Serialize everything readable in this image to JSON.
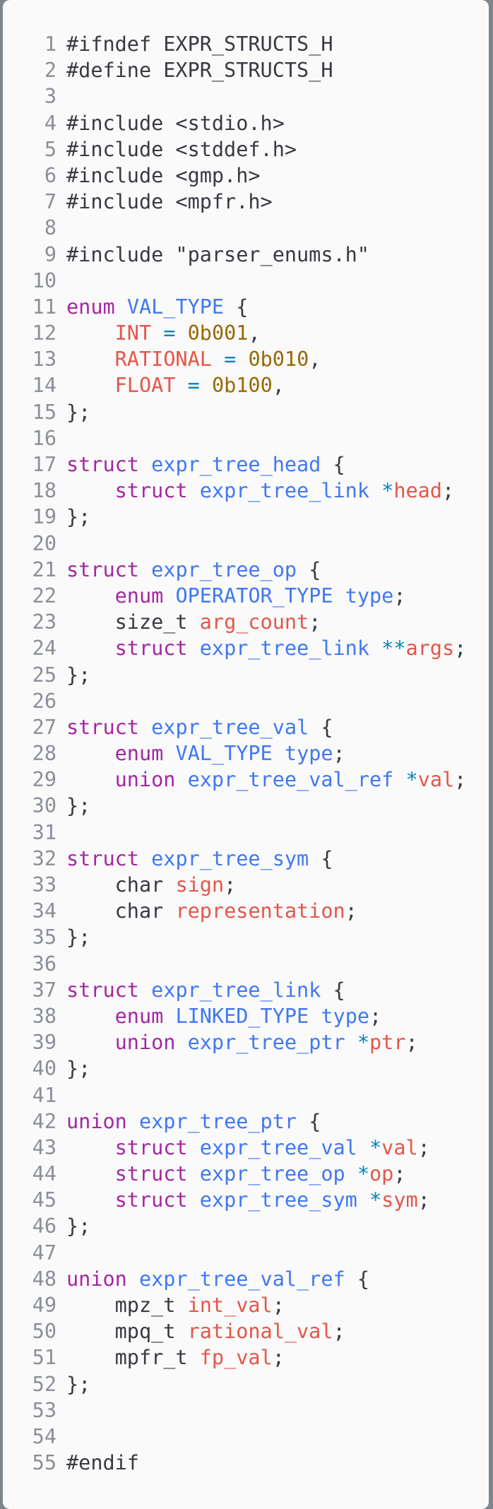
{
  "editor": {
    "language": "c",
    "lines": [
      {
        "n": "1",
        "t": [
          [
            "pp",
            "#ifndef EXPR_STRUCTS_H"
          ]
        ]
      },
      {
        "n": "2",
        "t": [
          [
            "pp",
            "#define EXPR_STRUCTS_H"
          ]
        ]
      },
      {
        "n": "3",
        "t": []
      },
      {
        "n": "4",
        "t": [
          [
            "pp",
            "#include <stdio.h>"
          ]
        ]
      },
      {
        "n": "5",
        "t": [
          [
            "pp",
            "#include <stddef.h>"
          ]
        ]
      },
      {
        "n": "6",
        "t": [
          [
            "pp",
            "#include <gmp.h>"
          ]
        ]
      },
      {
        "n": "7",
        "t": [
          [
            "pp",
            "#include <mpfr.h>"
          ]
        ]
      },
      {
        "n": "8",
        "t": []
      },
      {
        "n": "9",
        "t": [
          [
            "pp",
            "#include \"parser_enums.h\""
          ]
        ]
      },
      {
        "n": "10",
        "t": []
      },
      {
        "n": "11",
        "t": [
          [
            "kw",
            "enum"
          ],
          [
            "pp",
            " "
          ],
          [
            "ty",
            "VAL_TYPE"
          ],
          [
            "pp",
            " {"
          ]
        ]
      },
      {
        "n": "12",
        "t": [
          [
            "pp",
            "    "
          ],
          [
            "id",
            "INT"
          ],
          [
            "pp",
            " "
          ],
          [
            "op",
            "="
          ],
          [
            "pp",
            " "
          ],
          [
            "num",
            "0b001"
          ],
          [
            "pp",
            ","
          ]
        ]
      },
      {
        "n": "13",
        "t": [
          [
            "pp",
            "    "
          ],
          [
            "id",
            "RATIONAL"
          ],
          [
            "pp",
            " "
          ],
          [
            "op",
            "="
          ],
          [
            "pp",
            " "
          ],
          [
            "num",
            "0b010"
          ],
          [
            "pp",
            ","
          ]
        ]
      },
      {
        "n": "14",
        "t": [
          [
            "pp",
            "    "
          ],
          [
            "id",
            "FLOAT"
          ],
          [
            "pp",
            " "
          ],
          [
            "op",
            "="
          ],
          [
            "pp",
            " "
          ],
          [
            "num",
            "0b100"
          ],
          [
            "pp",
            ","
          ]
        ]
      },
      {
        "n": "15",
        "t": [
          [
            "pp",
            "};"
          ]
        ]
      },
      {
        "n": "16",
        "t": []
      },
      {
        "n": "17",
        "t": [
          [
            "kw",
            "struct"
          ],
          [
            "pp",
            " "
          ],
          [
            "ty",
            "expr_tree_head"
          ],
          [
            "pp",
            " {"
          ]
        ]
      },
      {
        "n": "18",
        "t": [
          [
            "pp",
            "    "
          ],
          [
            "kw",
            "struct"
          ],
          [
            "pp",
            " "
          ],
          [
            "ty",
            "expr_tree_link"
          ],
          [
            "pp",
            " "
          ],
          [
            "op",
            "*"
          ],
          [
            "id",
            "head"
          ],
          [
            "pp",
            ";"
          ]
        ]
      },
      {
        "n": "19",
        "t": [
          [
            "pp",
            "};"
          ]
        ]
      },
      {
        "n": "20",
        "t": []
      },
      {
        "n": "21",
        "t": [
          [
            "kw",
            "struct"
          ],
          [
            "pp",
            " "
          ],
          [
            "ty",
            "expr_tree_op"
          ],
          [
            "pp",
            " {"
          ]
        ]
      },
      {
        "n": "22",
        "t": [
          [
            "pp",
            "    "
          ],
          [
            "kw",
            "enum"
          ],
          [
            "pp",
            " "
          ],
          [
            "ty",
            "OPERATOR_TYPE"
          ],
          [
            "pp",
            " "
          ],
          [
            "ty",
            "type"
          ],
          [
            "pp",
            ";"
          ]
        ]
      },
      {
        "n": "23",
        "t": [
          [
            "pp",
            "    size_t "
          ],
          [
            "id",
            "arg_count"
          ],
          [
            "pp",
            ";"
          ]
        ]
      },
      {
        "n": "24",
        "t": [
          [
            "pp",
            "    "
          ],
          [
            "kw",
            "struct"
          ],
          [
            "pp",
            " "
          ],
          [
            "ty",
            "expr_tree_link"
          ],
          [
            "pp",
            " "
          ],
          [
            "op",
            "**"
          ],
          [
            "id",
            "args"
          ],
          [
            "pp",
            ";"
          ]
        ]
      },
      {
        "n": "25",
        "t": [
          [
            "pp",
            "};"
          ]
        ]
      },
      {
        "n": "26",
        "t": []
      },
      {
        "n": "27",
        "t": [
          [
            "kw",
            "struct"
          ],
          [
            "pp",
            " "
          ],
          [
            "ty",
            "expr_tree_val"
          ],
          [
            "pp",
            " {"
          ]
        ]
      },
      {
        "n": "28",
        "t": [
          [
            "pp",
            "    "
          ],
          [
            "kw",
            "enum"
          ],
          [
            "pp",
            " "
          ],
          [
            "ty",
            "VAL_TYPE"
          ],
          [
            "pp",
            " "
          ],
          [
            "ty",
            "type"
          ],
          [
            "pp",
            ";"
          ]
        ]
      },
      {
        "n": "29",
        "t": [
          [
            "pp",
            "    "
          ],
          [
            "kw",
            "union"
          ],
          [
            "pp",
            " "
          ],
          [
            "ty",
            "expr_tree_val_ref"
          ],
          [
            "pp",
            " "
          ],
          [
            "op",
            "*"
          ],
          [
            "id",
            "val"
          ],
          [
            "pp",
            ";"
          ]
        ]
      },
      {
        "n": "30",
        "t": [
          [
            "pp",
            "};"
          ]
        ]
      },
      {
        "n": "31",
        "t": []
      },
      {
        "n": "32",
        "t": [
          [
            "kw",
            "struct"
          ],
          [
            "pp",
            " "
          ],
          [
            "ty",
            "expr_tree_sym"
          ],
          [
            "pp",
            " {"
          ]
        ]
      },
      {
        "n": "33",
        "t": [
          [
            "pp",
            "    char "
          ],
          [
            "id",
            "sign"
          ],
          [
            "pp",
            ";"
          ]
        ]
      },
      {
        "n": "34",
        "t": [
          [
            "pp",
            "    char "
          ],
          [
            "id",
            "representation"
          ],
          [
            "pp",
            ";"
          ]
        ]
      },
      {
        "n": "35",
        "t": [
          [
            "pp",
            "};"
          ]
        ]
      },
      {
        "n": "36",
        "t": []
      },
      {
        "n": "37",
        "t": [
          [
            "kw",
            "struct"
          ],
          [
            "pp",
            " "
          ],
          [
            "ty",
            "expr_tree_link"
          ],
          [
            "pp",
            " {"
          ]
        ]
      },
      {
        "n": "38",
        "t": [
          [
            "pp",
            "    "
          ],
          [
            "kw",
            "enum"
          ],
          [
            "pp",
            " "
          ],
          [
            "ty",
            "LINKED_TYPE"
          ],
          [
            "pp",
            " "
          ],
          [
            "ty",
            "type"
          ],
          [
            "pp",
            ";"
          ]
        ]
      },
      {
        "n": "39",
        "t": [
          [
            "pp",
            "    "
          ],
          [
            "kw",
            "union"
          ],
          [
            "pp",
            " "
          ],
          [
            "ty",
            "expr_tree_ptr"
          ],
          [
            "pp",
            " "
          ],
          [
            "op",
            "*"
          ],
          [
            "id",
            "ptr"
          ],
          [
            "pp",
            ";"
          ]
        ]
      },
      {
        "n": "40",
        "t": [
          [
            "pp",
            "};"
          ]
        ]
      },
      {
        "n": "41",
        "t": []
      },
      {
        "n": "42",
        "t": [
          [
            "kw",
            "union"
          ],
          [
            "pp",
            " "
          ],
          [
            "ty",
            "expr_tree_ptr"
          ],
          [
            "pp",
            " {"
          ]
        ]
      },
      {
        "n": "43",
        "t": [
          [
            "pp",
            "    "
          ],
          [
            "kw",
            "struct"
          ],
          [
            "pp",
            " "
          ],
          [
            "ty",
            "expr_tree_val"
          ],
          [
            "pp",
            " "
          ],
          [
            "op",
            "*"
          ],
          [
            "id",
            "val"
          ],
          [
            "pp",
            ";"
          ]
        ]
      },
      {
        "n": "44",
        "t": [
          [
            "pp",
            "    "
          ],
          [
            "kw",
            "struct"
          ],
          [
            "pp",
            " "
          ],
          [
            "ty",
            "expr_tree_op"
          ],
          [
            "pp",
            " "
          ],
          [
            "op",
            "*"
          ],
          [
            "id",
            "op"
          ],
          [
            "pp",
            ";"
          ]
        ]
      },
      {
        "n": "45",
        "t": [
          [
            "pp",
            "    "
          ],
          [
            "kw",
            "struct"
          ],
          [
            "pp",
            " "
          ],
          [
            "ty",
            "expr_tree_sym"
          ],
          [
            "pp",
            " "
          ],
          [
            "op",
            "*"
          ],
          [
            "id",
            "sym"
          ],
          [
            "pp",
            ";"
          ]
        ]
      },
      {
        "n": "46",
        "t": [
          [
            "pp",
            "};"
          ]
        ]
      },
      {
        "n": "47",
        "t": []
      },
      {
        "n": "48",
        "t": [
          [
            "kw",
            "union"
          ],
          [
            "pp",
            " "
          ],
          [
            "ty",
            "expr_tree_val_ref"
          ],
          [
            "pp",
            " {"
          ]
        ]
      },
      {
        "n": "49",
        "t": [
          [
            "pp",
            "    mpz_t "
          ],
          [
            "id",
            "int_val"
          ],
          [
            "pp",
            ";"
          ]
        ]
      },
      {
        "n": "50",
        "t": [
          [
            "pp",
            "    mpq_t "
          ],
          [
            "id",
            "rational_val"
          ],
          [
            "pp",
            ";"
          ]
        ]
      },
      {
        "n": "51",
        "t": [
          [
            "pp",
            "    mpfr_t "
          ],
          [
            "id",
            "fp_val"
          ],
          [
            "pp",
            ";"
          ]
        ]
      },
      {
        "n": "52",
        "t": [
          [
            "pp",
            "};"
          ]
        ]
      },
      {
        "n": "53",
        "t": []
      },
      {
        "n": "54",
        "t": []
      },
      {
        "n": "55",
        "t": [
          [
            "pp",
            "#endif"
          ]
        ]
      }
    ]
  }
}
